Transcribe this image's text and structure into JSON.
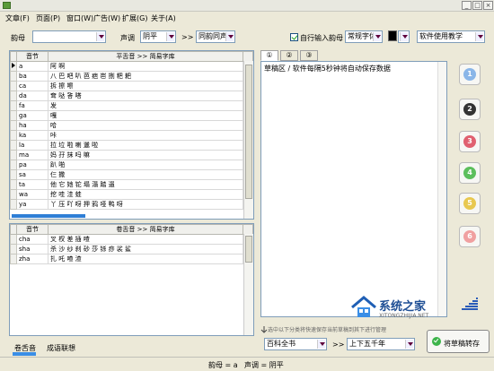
{
  "menu": {
    "items": [
      "文章(F)",
      "页面(P)",
      "窗口(W)",
      "广告(W)",
      "扩展(G)",
      "关于(A)"
    ]
  },
  "toolbar": {
    "rhyme_label": "韵母",
    "rhyme_value": "",
    "tone_label": "声调",
    "tone_value": "阴平",
    "arrows": ">>",
    "tone_mode": "同韵同声",
    "auto_input_label": "自行输入韵母",
    "font_style": "常规字体",
    "tutorial": "软件使用教学"
  },
  "table1": {
    "headers": [
      "音节",
      "平舌音 >> 简易字库"
    ],
    "rows": [
      [
        "a",
        "阿 啊"
      ],
      [
        "ba",
        "八 巴 吧 叭 芭 疤 岜 捌 粑 耙"
      ],
      [
        "ca",
        "拆 擦 嚓"
      ],
      [
        "da",
        "耷 哒 答 嗒"
      ],
      [
        "fa",
        "发"
      ],
      [
        "ga",
        "嘎"
      ],
      [
        "ha",
        "哈"
      ],
      [
        "ka",
        "咔"
      ],
      [
        "la",
        "拉 垃 啦 喇 邋 啦"
      ],
      [
        "ma",
        "妈 孖 抹 吗 嘛"
      ],
      [
        "pa",
        "趴 啪"
      ],
      [
        "sa",
        "仨 撒"
      ],
      [
        "ta",
        "他 它 她 铊 塌 溻 踏 遢"
      ],
      [
        "wa",
        "挖 哇 洼 蛙"
      ],
      [
        "ya",
        "丫 压 吖 呀 押 鸦 哑 鸭 呀"
      ]
    ]
  },
  "table2": {
    "headers": [
      "音节",
      "卷舌音 >> 简易字库"
    ],
    "rows": [
      [
        "cha",
        "叉 杈 差 插 喳"
      ],
      [
        "sha",
        "杀 沙 纱 刹 砂 莎 铩 痧 裟 鲨"
      ],
      [
        "zha",
        "扎 吒 喳 渣"
      ]
    ]
  },
  "editor": {
    "tabs": [
      "①",
      "②",
      "③"
    ],
    "content": "草稿区 / 软件每隔5秒钟将自动保存数据"
  },
  "side_buttons": [
    {
      "label": "1",
      "color": "#8ab6e8"
    },
    {
      "label": "2",
      "color": "#333333"
    },
    {
      "label": "3",
      "color": "#e06070"
    },
    {
      "label": "4",
      "color": "#5cbf5c"
    },
    {
      "label": "5",
      "color": "#e8c850"
    },
    {
      "label": "6",
      "color": "#f0a0a0"
    }
  ],
  "footer": {
    "hint": "选中以下分类将快速保存当前草稿到其下进行管理",
    "category": "百科全书",
    "arrows": ">>",
    "subcategory": "上下五千年",
    "save_button": "将草稿转存",
    "tab_left1": "卷舌音",
    "tab_left2": "成语联想"
  },
  "status": {
    "rhyme": "韵母 = a",
    "tone": "声调 = 阴平"
  },
  "watermark": {
    "text": "系统之家",
    "url": "XITONGZHIJIA.NET"
  }
}
